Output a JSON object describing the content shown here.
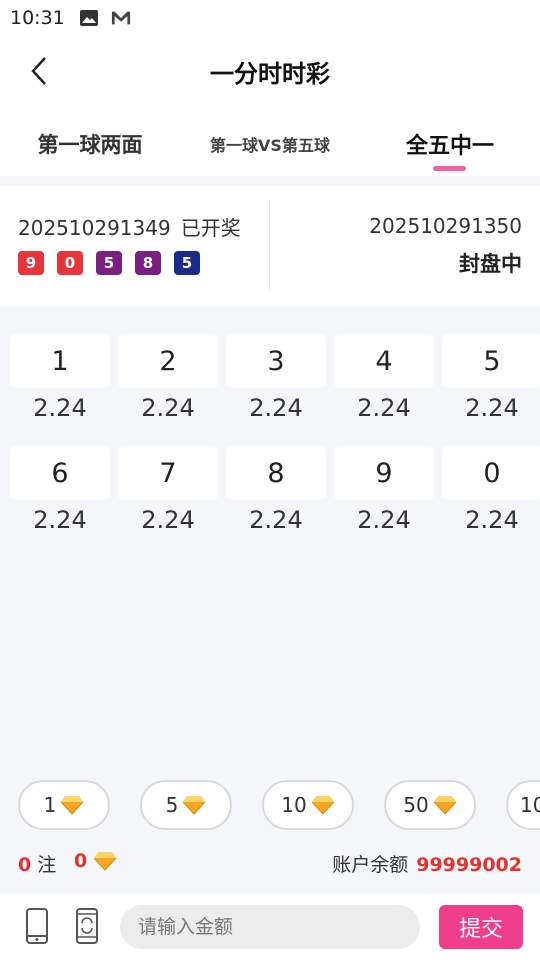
{
  "status_bar": {
    "time": "10:31"
  },
  "header": {
    "title": "一分时时彩"
  },
  "tabs": [
    {
      "label": "第一球两面"
    },
    {
      "label": "第一球VS第五球"
    },
    {
      "label": "全五中一"
    }
  ],
  "draw": {
    "current_issue": "202510291349",
    "current_status": "已开奖",
    "balls": [
      {
        "number": "9",
        "color": "#e8343a"
      },
      {
        "number": "0",
        "color": "#e8343a"
      },
      {
        "number": "5",
        "color": "#7a1f7e"
      },
      {
        "number": "8",
        "color": "#7a1f7e"
      },
      {
        "number": "5",
        "color": "#1a2a8a"
      }
    ],
    "next_issue": "202510291350",
    "next_status": "封盘中"
  },
  "bets": [
    {
      "number": "1",
      "odds": "2.24"
    },
    {
      "number": "2",
      "odds": "2.24"
    },
    {
      "number": "3",
      "odds": "2.24"
    },
    {
      "number": "4",
      "odds": "2.24"
    },
    {
      "number": "5",
      "odds": "2.24"
    },
    {
      "number": "6",
      "odds": "2.24"
    },
    {
      "number": "7",
      "odds": "2.24"
    },
    {
      "number": "8",
      "odds": "2.24"
    },
    {
      "number": "9",
      "odds": "2.24"
    },
    {
      "number": "0",
      "odds": "2.24"
    }
  ],
  "chips": [
    {
      "value": "1"
    },
    {
      "value": "5"
    },
    {
      "value": "10"
    },
    {
      "value": "50"
    },
    {
      "value": "10"
    }
  ],
  "summary": {
    "bet_count": "0",
    "bet_unit": "注",
    "bet_amount": "0",
    "balance_label": "账户余额",
    "balance_value": "99999002"
  },
  "bottom": {
    "input_placeholder": "请输入金额",
    "submit_label": "提交"
  },
  "colors": {
    "accent": "#ef3d8c",
    "tab_indicator": "#f0639a",
    "highlight_red": "#e6322e"
  }
}
